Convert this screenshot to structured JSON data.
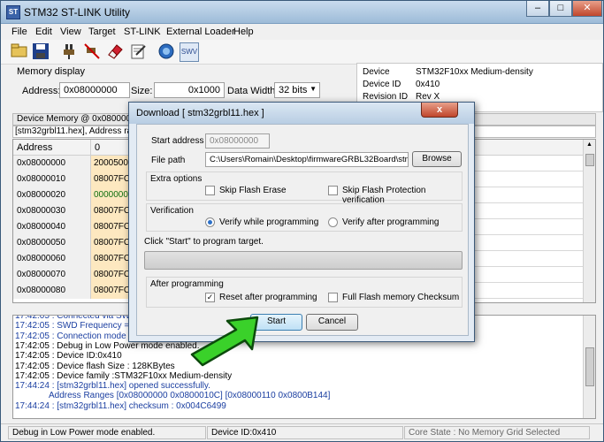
{
  "window": {
    "title": "STM32 ST-LINK Utility",
    "min": "–",
    "max": "□",
    "close": "✕"
  },
  "menu": [
    "File",
    "Edit",
    "View",
    "Target",
    "ST-LINK",
    "External Loader",
    "Help"
  ],
  "toolbar": {
    "icons": [
      "open-icon",
      "save-icon",
      "connect-icon",
      "disconnect-icon",
      "erase-icon",
      "program-icon",
      "verify-icon",
      "swv-icon"
    ],
    "swv_label": "SWV"
  },
  "memory_display": {
    "group_label": "Memory display",
    "address_label": "Address:",
    "address_value": "0x08000000",
    "size_label": "Size:",
    "size_value": "0x1000",
    "width_label": "Data Width:",
    "width_value": "32 bits"
  },
  "device_info": {
    "rows": [
      {
        "k": "Device",
        "v": "STM32F10xx Medium-density"
      },
      {
        "k": "Device ID",
        "v": "0x410"
      },
      {
        "k": "Revision ID",
        "v": "Rev X"
      }
    ]
  },
  "tabs": {
    "device_memory": "Device Memory @ 0x08000000 :",
    "file_tab": "[stm32grbl11.hex], Address range"
  },
  "grid": {
    "headers": [
      "Address",
      "0"
    ],
    "rows": [
      {
        "addr": "0x08000000",
        "v": "20005000"
      },
      {
        "addr": "0x08000010",
        "v": "08007FC1"
      },
      {
        "addr": "0x08000020",
        "v": "00000000"
      },
      {
        "addr": "0x08000030",
        "v": "08007FC1"
      },
      {
        "addr": "0x08000040",
        "v": "08007FC1"
      },
      {
        "addr": "0x08000050",
        "v": "08007FC1"
      },
      {
        "addr": "0x08000060",
        "v": "08007FC1"
      },
      {
        "addr": "0x08000070",
        "v": "08007FC1"
      },
      {
        "addr": "0x08000080",
        "v": "08007FC1"
      }
    ]
  },
  "log": [
    "17:42:05 : Connected via SWD.",
    "17:42:05 : SWD Frequency = 4,0",
    "17:42:05 : Connection mode : No",
    "17:42:05 : Debug in Low Power mode enabled.",
    "17:42:05 : Device ID:0x410",
    "17:42:05 : Device flash Size : 128KBytes",
    "17:42:05 : Device family :STM32F10xx Medium-density",
    "17:44:24 : [stm32grbl11.hex] opened successfully.",
    "Address Ranges [0x08000000 0x0800010C] [0x08000110 0x0800B144]",
    "17:44:24 : [stm32grbl11.hex] checksum : 0x004C6499"
  ],
  "status": {
    "left": "Debug in Low Power mode enabled.",
    "mid": "Device ID:0x410",
    "right": "Core State : No Memory Grid Selected"
  },
  "dialog": {
    "title": "Download [ stm32grbl11.hex ]",
    "close": "x",
    "start_address_label": "Start address",
    "start_address_value": "0x08000000",
    "file_path_label": "File path",
    "file_path_value": "C:\\Users\\Romain\\Desktop\\firmwareGRBL32Board\\stm32g",
    "browse": "Browse",
    "extra_options": "Extra options",
    "skip_flash_erase": "Skip Flash Erase",
    "skip_protection": "Skip Flash Protection verification",
    "verification": "Verification",
    "verify_while": "Verify while programming",
    "verify_after": "Verify after programming",
    "hint": "Click \"Start\" to program target.",
    "after_programming": "After programming",
    "reset_after": "Reset after programming",
    "full_checksum": "Full Flash memory Checksum",
    "start": "Start",
    "cancel": "Cancel",
    "progress": 0
  },
  "colors": {
    "accent": "#2c70c8",
    "arrow": "#3ad12a",
    "log_text": "#1a3ea0"
  }
}
